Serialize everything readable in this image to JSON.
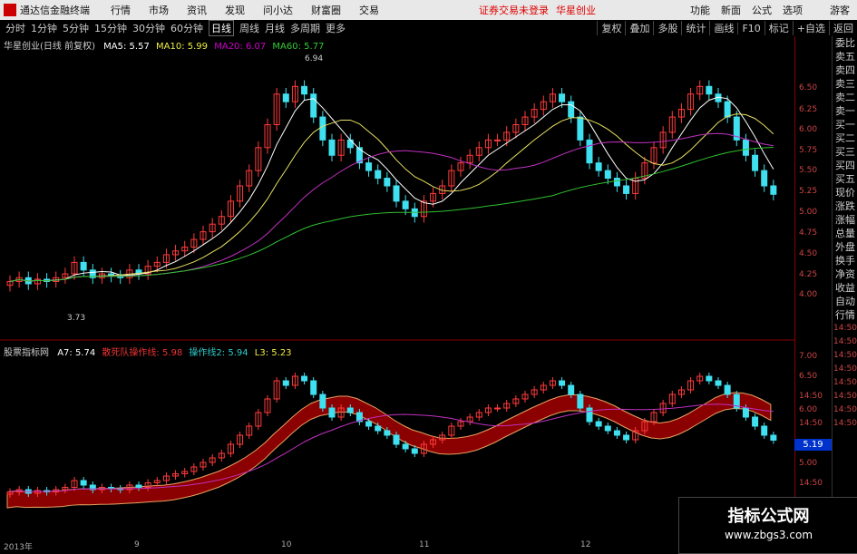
{
  "titlebar": {
    "app_name": "通达信金融终端",
    "menus": [
      "行情",
      "市场",
      "资讯",
      "发现",
      "问小达",
      "财富圈",
      "交易"
    ],
    "notice": "证券交易未登录",
    "broker": "华星创业",
    "right_items": [
      "功能",
      "新面",
      "公式",
      "选项",
      "游客"
    ]
  },
  "toolbar": {
    "timeframes": [
      "分时",
      "1分钟",
      "5分钟",
      "15分钟",
      "30分钟",
      "60分钟",
      "日线",
      "周线",
      "月线",
      "多周期",
      "更多"
    ],
    "active": "日线",
    "right_items": [
      "复权",
      "叠加",
      "多股",
      "统计",
      "画线",
      "F10",
      "标记",
      "+自选",
      "返回"
    ]
  },
  "upper_legend": {
    "stock": "华星创业(日线 前复权)",
    "ma5": "MA5: 5.57",
    "ma10": "MA10: 5.99",
    "ma20": "MA20: 6.07",
    "ma60": "MA60: 5.77",
    "high_label": "6.94",
    "low_label": "3.73"
  },
  "lower_legend": {
    "name": "股票指标网",
    "a7": "A7: 5.74",
    "line1": "散死队操作线: 5.98",
    "line2": "操作线2: 5.94",
    "l3": "L3: 5.23"
  },
  "upper_axis": [
    "6.50",
    "6.25",
    "6.00",
    "5.75",
    "5.50",
    "5.25",
    "5.00",
    "4.75",
    "4.50",
    "4.25",
    "4.00"
  ],
  "lower_axis": [
    "7.00",
    "6.50",
    "14:50",
    "6.00",
    "14:50",
    "14:50",
    "5.00",
    "14:50"
  ],
  "price_label": "5.19",
  "date_axis": [
    "2013年",
    "9",
    "10",
    "11",
    "12"
  ],
  "right_panel": [
    "委比",
    "卖五",
    "卖四",
    "卖三",
    "卖二",
    "卖一",
    "买一",
    "买二",
    "买三",
    "买四",
    "买五",
    "现价",
    "涨跌",
    "涨幅",
    "总量",
    "外盘",
    "换手",
    "净资",
    "收益",
    "自动",
    "行情",
    "14:50",
    "14:50",
    "14:50",
    "14:50",
    "14:50",
    "14:50",
    "14:50",
    "14:50"
  ],
  "watermark": {
    "title": "指标公式网",
    "url": "www.zbgs3.com"
  },
  "chart_data": {
    "type": "candlestick",
    "closes": [
      4.05,
      4.1,
      4.02,
      4.08,
      4.05,
      4.1,
      4.15,
      4.3,
      4.2,
      4.1,
      4.15,
      4.12,
      4.1,
      4.2,
      4.15,
      4.25,
      4.3,
      4.4,
      4.45,
      4.5,
      4.6,
      4.7,
      4.8,
      4.9,
      5.1,
      5.3,
      5.5,
      5.8,
      6.1,
      6.5,
      6.4,
      6.6,
      6.5,
      6.2,
      5.9,
      5.7,
      5.9,
      5.8,
      5.6,
      5.5,
      5.4,
      5.3,
      5.1,
      5.0,
      4.9,
      5.1,
      5.2,
      5.3,
      5.5,
      5.6,
      5.7,
      5.8,
      5.9,
      5.9,
      6.0,
      6.1,
      6.2,
      6.3,
      6.4,
      6.5,
      6.4,
      6.2,
      5.9,
      5.6,
      5.5,
      5.4,
      5.3,
      5.2,
      5.4,
      5.6,
      5.8,
      6.0,
      6.2,
      6.3,
      6.5,
      6.6,
      6.5,
      6.4,
      6.2,
      5.9,
      5.7,
      5.5,
      5.3,
      5.19
    ],
    "ma_values": {
      "MA5": 5.57,
      "MA10": 5.99,
      "MA20": 6.07,
      "MA60": 5.77
    }
  }
}
